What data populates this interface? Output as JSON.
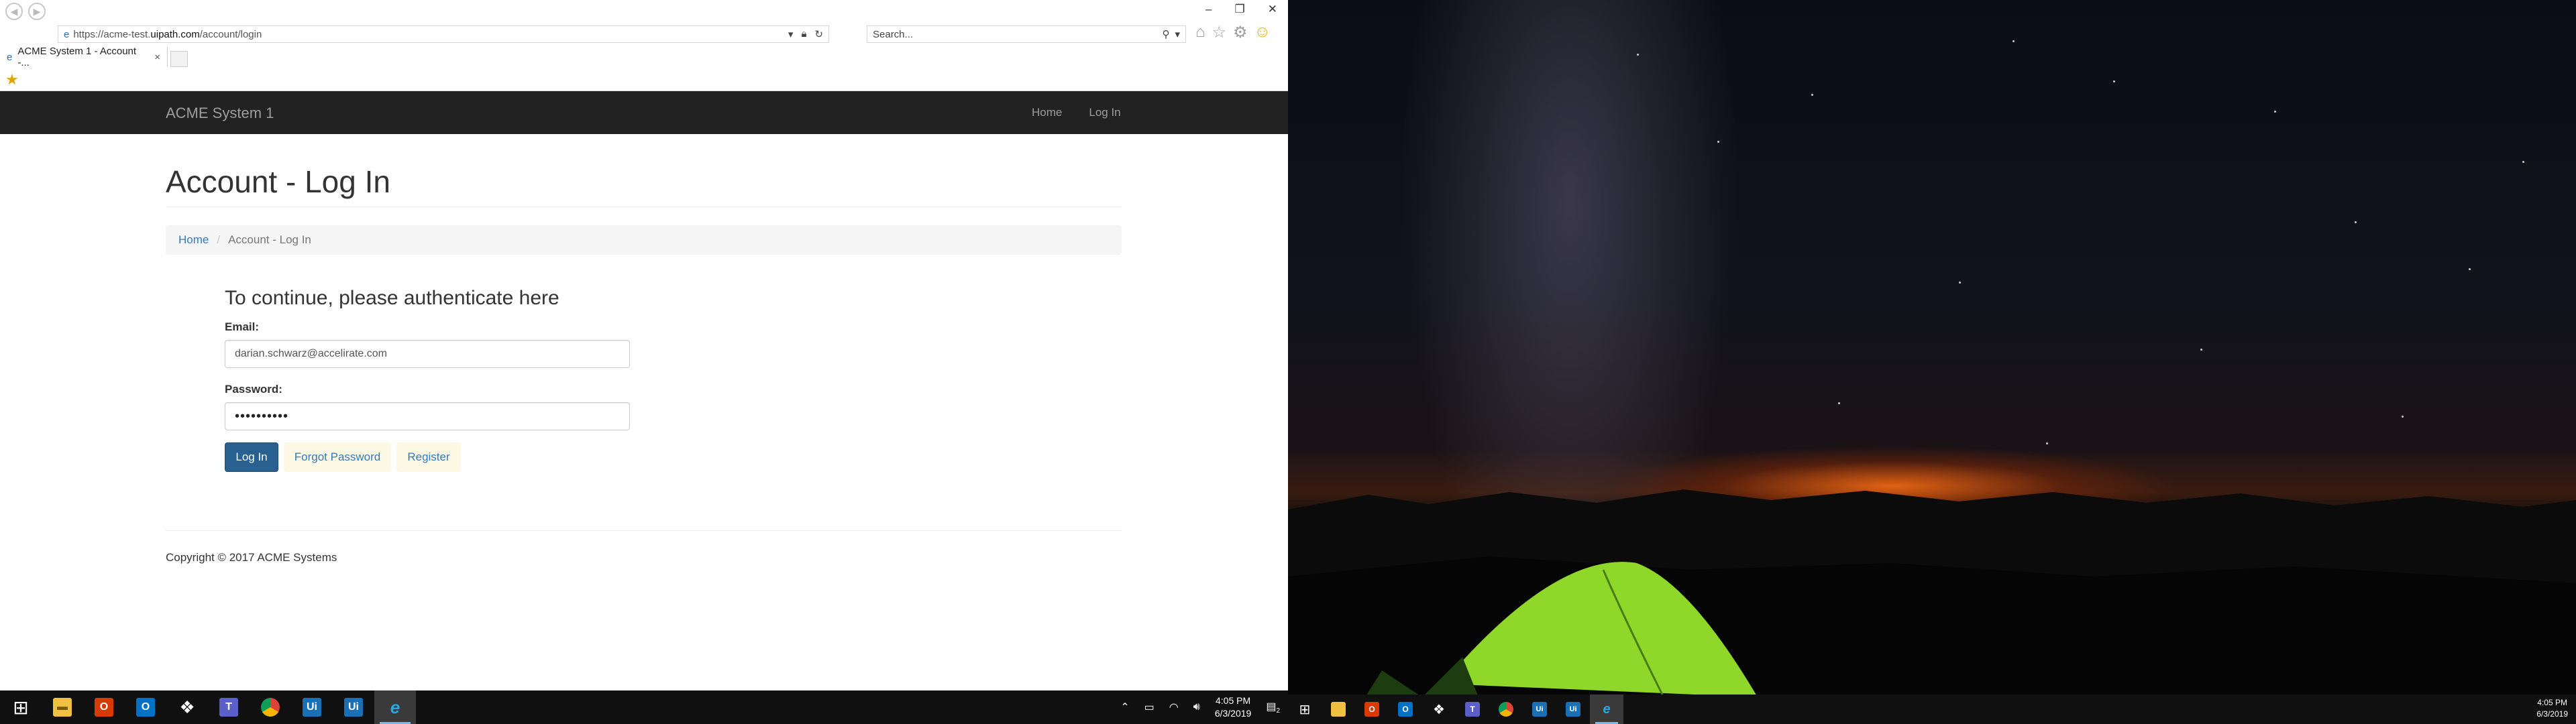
{
  "browser": {
    "address_url_prefix": "https://acme-test.",
    "address_url_domain": "uipath.com",
    "address_url_path": "/account/login",
    "search_placeholder": "Search...",
    "tab_title": "ACME System 1 - Account -...",
    "window_controls": {
      "minimize": "–",
      "restore": "❐",
      "close": "✕"
    }
  },
  "site": {
    "brand": "ACME System 1",
    "nav": {
      "home": "Home",
      "login": "Log In"
    },
    "page_title": "Account - Log In",
    "breadcrumb": {
      "home": "Home",
      "separator": "/",
      "current": "Account - Log In"
    },
    "form": {
      "heading": "To continue, please authenticate here",
      "email_label": "Email:",
      "email_value": "darian.schwarz@accelirate.com",
      "password_label": "Password:",
      "password_value": "••••••••••",
      "login_button": "Log In",
      "forgot_button": "Forgot Password",
      "register_button": "Register"
    },
    "footer": {
      "copyright": "Copyright © 2017 ACME Systems"
    }
  },
  "taskbar": {
    "time": "4:05 PM",
    "date": "6/3/2019",
    "notification_count": "2",
    "apps": [
      "start",
      "file-explorer",
      "office",
      "outlook",
      "dropbox",
      "teams",
      "chrome",
      "uipath-studio",
      "uipath-robot",
      "internet-explorer"
    ]
  },
  "taskbar_secondary": {
    "time": "4:05 PM",
    "date": "6/3/2019"
  },
  "colors": {
    "navbar": "#222222",
    "primary_button": "#286090",
    "link": "#337ab7",
    "taskbar": "#101010"
  }
}
